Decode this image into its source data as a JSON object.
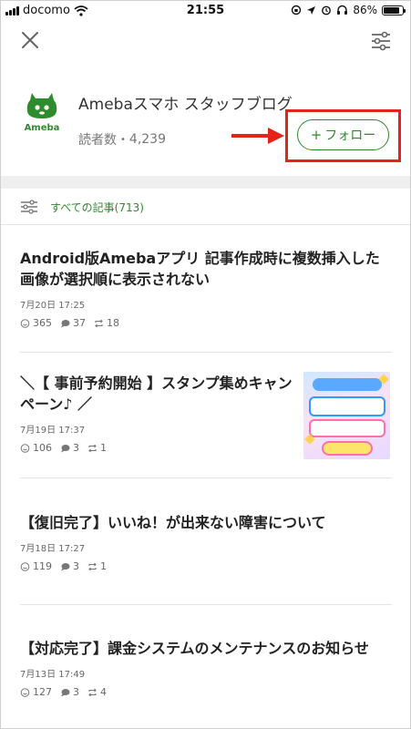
{
  "status_bar": {
    "carrier": "docomo",
    "time": "21:55",
    "battery": "86%",
    "battery_level": 0.86
  },
  "nav": {
    "close_icon": "close-icon",
    "menu_icon": "sliders-menu-icon"
  },
  "blog": {
    "logo_text": "Ameba",
    "title": "Amebaスマホ スタッフブログ",
    "readers_label": "読者数",
    "readers_count": "4,239",
    "follow_plus": "+",
    "follow_label": "フォロー"
  },
  "filter": {
    "label": "すべての記事(713)"
  },
  "articles": [
    {
      "title": "Android版Amebaアプリ 記事作成時に複数挿入した画像が選択順に表示されない",
      "date": "7月20日 17:25",
      "likes": "365",
      "comments": "37",
      "reblogs": "18"
    },
    {
      "title": "＼【 事前予約開始 】スタンプ集めキャンペーン♪ ／",
      "date": "7月19日 17:37",
      "likes": "106",
      "comments": "3",
      "reblogs": "1"
    },
    {
      "title": "【復旧完了】いいね！が出来ない障害について",
      "date": "7月18日 17:27",
      "likes": "119",
      "comments": "3",
      "reblogs": "1"
    },
    {
      "title": "【対応完了】課金システムのメンテナンスのお知らせ",
      "date": "7月13日 17:49",
      "likes": "127",
      "comments": "3",
      "reblogs": "4"
    }
  ],
  "colors": {
    "accent_green": "#2d8a2d",
    "highlight_red": "#e6231a"
  }
}
